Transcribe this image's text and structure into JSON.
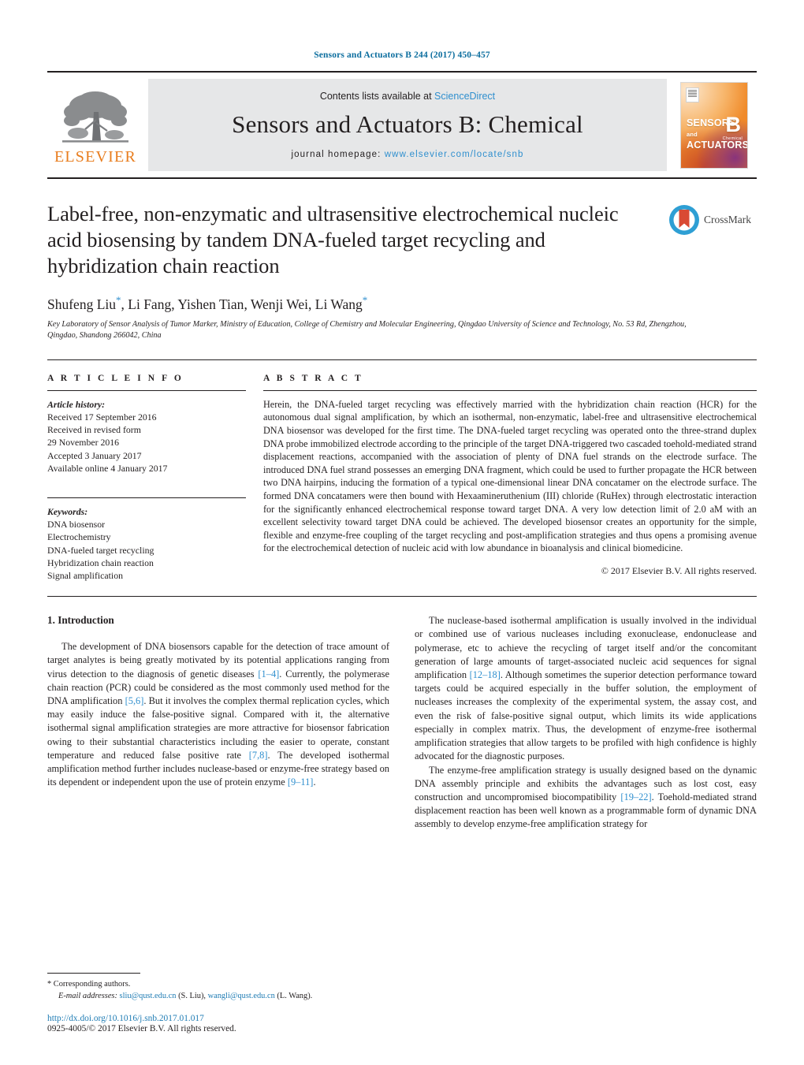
{
  "running_head": "Sensors and Actuators B 244 (2017) 450–457",
  "masthead": {
    "contents_prefix": "Contents lists available at ",
    "sciencedirect": "ScienceDirect",
    "journal_title": "Sensors and Actuators B: Chemical",
    "homepage_label": "journal homepage: ",
    "homepage_url": "www.elsevier.com/locate/snb",
    "publisher_name": "ELSEVIER",
    "publisher_color": "#e87d1e",
    "cover": {
      "line1": "SENSORS",
      "line1_suffix": "and",
      "line2": "ACTUATORS",
      "letter": "B",
      "letter_sub": "Chemical"
    }
  },
  "article": {
    "title": "Label-free, non-enzymatic and ultrasensitive electrochemical nucleic acid biosensing by tandem DNA-fueled target recycling and hybridization chain reaction",
    "authors": "Shufeng Liu",
    "authors_full": "Shufeng Liu*, Li Fang, Yishen Tian, Wenji Wei, Li Wang*",
    "author_list": [
      {
        "name": "Shufeng Liu",
        "corresponding": true
      },
      {
        "name": "Li Fang",
        "corresponding": false
      },
      {
        "name": "Yishen Tian",
        "corresponding": false
      },
      {
        "name": "Wenji Wei",
        "corresponding": false
      },
      {
        "name": "Li Wang",
        "corresponding": true
      }
    ],
    "affiliation": "Key Laboratory of Sensor Analysis of Tumor Marker, Ministry of Education, College of Chemistry and Molecular Engineering, Qingdao University of Science and Technology, No. 53 Rd, Zhengzhou, Qingdao, Shandong 266042, China",
    "crossmark_label": "CrossMark"
  },
  "article_info": {
    "heading": "A R T I C L E   I N F O",
    "history_label": "Article history:",
    "history": [
      "Received 17 September 2016",
      "Received in revised form",
      "29 November 2016",
      "Accepted 3 January 2017",
      "Available online 4 January 2017"
    ],
    "keywords_label": "Keywords:",
    "keywords": [
      "DNA biosensor",
      "Electrochemistry",
      "DNA-fueled target recycling",
      "Hybridization chain reaction",
      "Signal amplification"
    ]
  },
  "abstract": {
    "heading": "A B S T R A C T",
    "text": "Herein, the DNA-fueled target recycling was effectively married with the hybridization chain reaction (HCR) for the autonomous dual signal amplification, by which an isothermal, non-enzymatic, label-free and ultrasensitive electrochemical DNA biosensor was developed for the first time. The DNA-fueled target recycling was operated onto the three-strand duplex DNA probe immobilized electrode according to the principle of the target DNA-triggered two cascaded toehold-mediated strand displacement reactions, accompanied with the association of plenty of DNA fuel strands on the electrode surface. The introduced DNA fuel strand possesses an emerging DNA fragment, which could be used to further propagate the HCR between two DNA hairpins, inducing the formation of a typical one-dimensional linear DNA concatamer on the electrode surface. The formed DNA concatamers were then bound with Hexaamineruthenium (III) chloride (RuHex) through electrostatic interaction for the significantly enhanced electrochemical response toward target DNA. A very low detection limit of 2.0 aM with an excellent selectivity toward target DNA could be achieved. The developed biosensor creates an opportunity for the simple, flexible and enzyme-free coupling of the target recycling and post-amplification strategies and thus opens a promising avenue for the electrochemical detection of nucleic acid with low abundance in bioanalysis and clinical biomedicine.",
    "copyright": "© 2017 Elsevier B.V. All rights reserved."
  },
  "body": {
    "section_number_title": "1.  Introduction",
    "left_para_1_a": "The development of DNA biosensors capable for the detection of trace amount of target analytes is being greatly motivated by its potential applications ranging from virus detection to the diagnosis of genetic diseases ",
    "left_cite_1": "[1–4]",
    "left_para_1_b": ". Currently, the polymerase chain reaction (PCR) could be considered as the most commonly used method for the DNA amplification ",
    "left_cite_2": "[5,6]",
    "left_para_1_c": ". But it involves the complex thermal replication cycles, which may easily induce the false-positive signal. Compared with it, the alternative isothermal signal amplification strategies are more attractive for biosensor fabrication owing to their substantial characteristics including the easier to operate, constant temperature and reduced false positive rate ",
    "left_cite_3": "[7,8]",
    "left_para_1_d": ". The developed isothermal amplification method further includes nuclease-based or enzyme-free strategy based on its dependent or independent upon the use of protein enzyme ",
    "left_cite_4": "[9–11]",
    "left_para_1_e": ".",
    "right_para_1_a": "The nuclease-based isothermal amplification is usually involved in the individual or combined use of various nucleases including exonuclease, endonuclease and polymerase, etc to achieve the recycling of target itself and/or the concomitant generation of large amounts of target-associated nucleic acid sequences for signal amplification ",
    "right_cite_1": "[12–18]",
    "right_para_1_b": ". Although sometimes the superior detection performance toward targets could be acquired especially in the buffer solution, the employment of nucleases increases the complexity of the experimental system, the assay cost, and even the risk of false-positive signal output, which limits its wide applications especially in complex matrix. Thus, the development of enzyme-free isothermal amplification strategies that allow targets to be profiled with high confidence is highly advocated for the diagnostic purposes.",
    "right_para_2_a": "The enzyme-free amplification strategy is usually designed based on the dynamic DNA assembly principle and exhibits the advantages such as lost cost, easy construction and uncompromised biocompatibility ",
    "right_cite_2": "[19–22]",
    "right_para_2_b": ". Toehold-mediated strand displacement reaction has been well known as a programmable form of dynamic DNA assembly to develop enzyme-free amplification strategy for"
  },
  "footnote": {
    "corresponding": "* Corresponding authors.",
    "email_label": "E-mail addresses:",
    "email_1": "sliu@qust.edu.cn",
    "email_1_owner": "(S. Liu),",
    "email_2": "wangli@qust.edu.cn",
    "email_2_owner": "(L. Wang).",
    "doi": "http://dx.doi.org/10.1016/j.snb.2017.01.017",
    "issn_line": "0925-4005/© 2017 Elsevier B.V. All rights reserved."
  },
  "colors": {
    "link": "#2f8fce",
    "header_blue": "#0b6d9e",
    "elsevier_orange": "#e87d1e"
  }
}
